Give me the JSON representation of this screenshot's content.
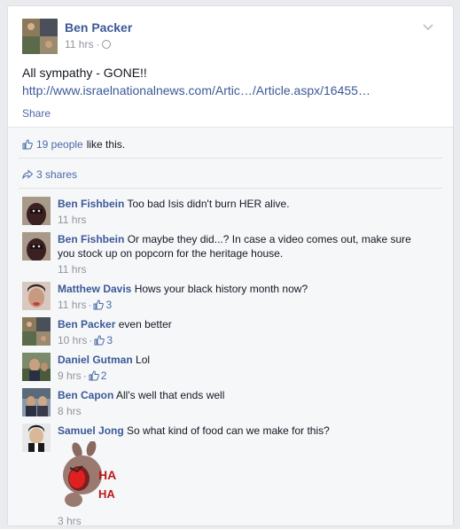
{
  "post": {
    "author": "Ben Packer",
    "time": "11 hrs",
    "meta_sep": "·",
    "text": "All sympathy - GONE!!",
    "link": "http://www.israelnationalnews.com/Artic…/Article.aspx/16455…",
    "share_label": "Share"
  },
  "ufi": {
    "likes_count": "19 people",
    "likes_suffix": "like this.",
    "shares": "3 shares"
  },
  "comments": [
    {
      "name": "Ben Fishbein",
      "text": "Too bad Isis didn't burn HER alive.",
      "time": "11 hrs",
      "likes": ""
    },
    {
      "name": "Ben Fishbein",
      "text": "Or maybe they did...? In case a video comes out, make sure you stock up on popcorn for the heritage house.",
      "time": "11 hrs",
      "likes": ""
    },
    {
      "name": "Matthew Davis",
      "text": "Hows your black history month now?",
      "time": "11 hrs",
      "likes": "3"
    },
    {
      "name": "Ben Packer",
      "text": "even better",
      "time": "10 hrs",
      "likes": "3"
    },
    {
      "name": "Daniel Gutman",
      "text": "Lol",
      "time": "9 hrs",
      "likes": "2"
    },
    {
      "name": "Ben Capon",
      "text": "All's well that ends well",
      "time": "8 hrs",
      "likes": ""
    },
    {
      "name": "Samuel Jong",
      "text": "So what kind of food can we make for this?",
      "time": "3 hrs",
      "likes": "",
      "sticker_text_1": "HA",
      "sticker_text_2": "HA"
    }
  ],
  "colors": {
    "link": "#3b5998",
    "meta": "#90949c",
    "ufi_bg": "#f6f7f9"
  }
}
